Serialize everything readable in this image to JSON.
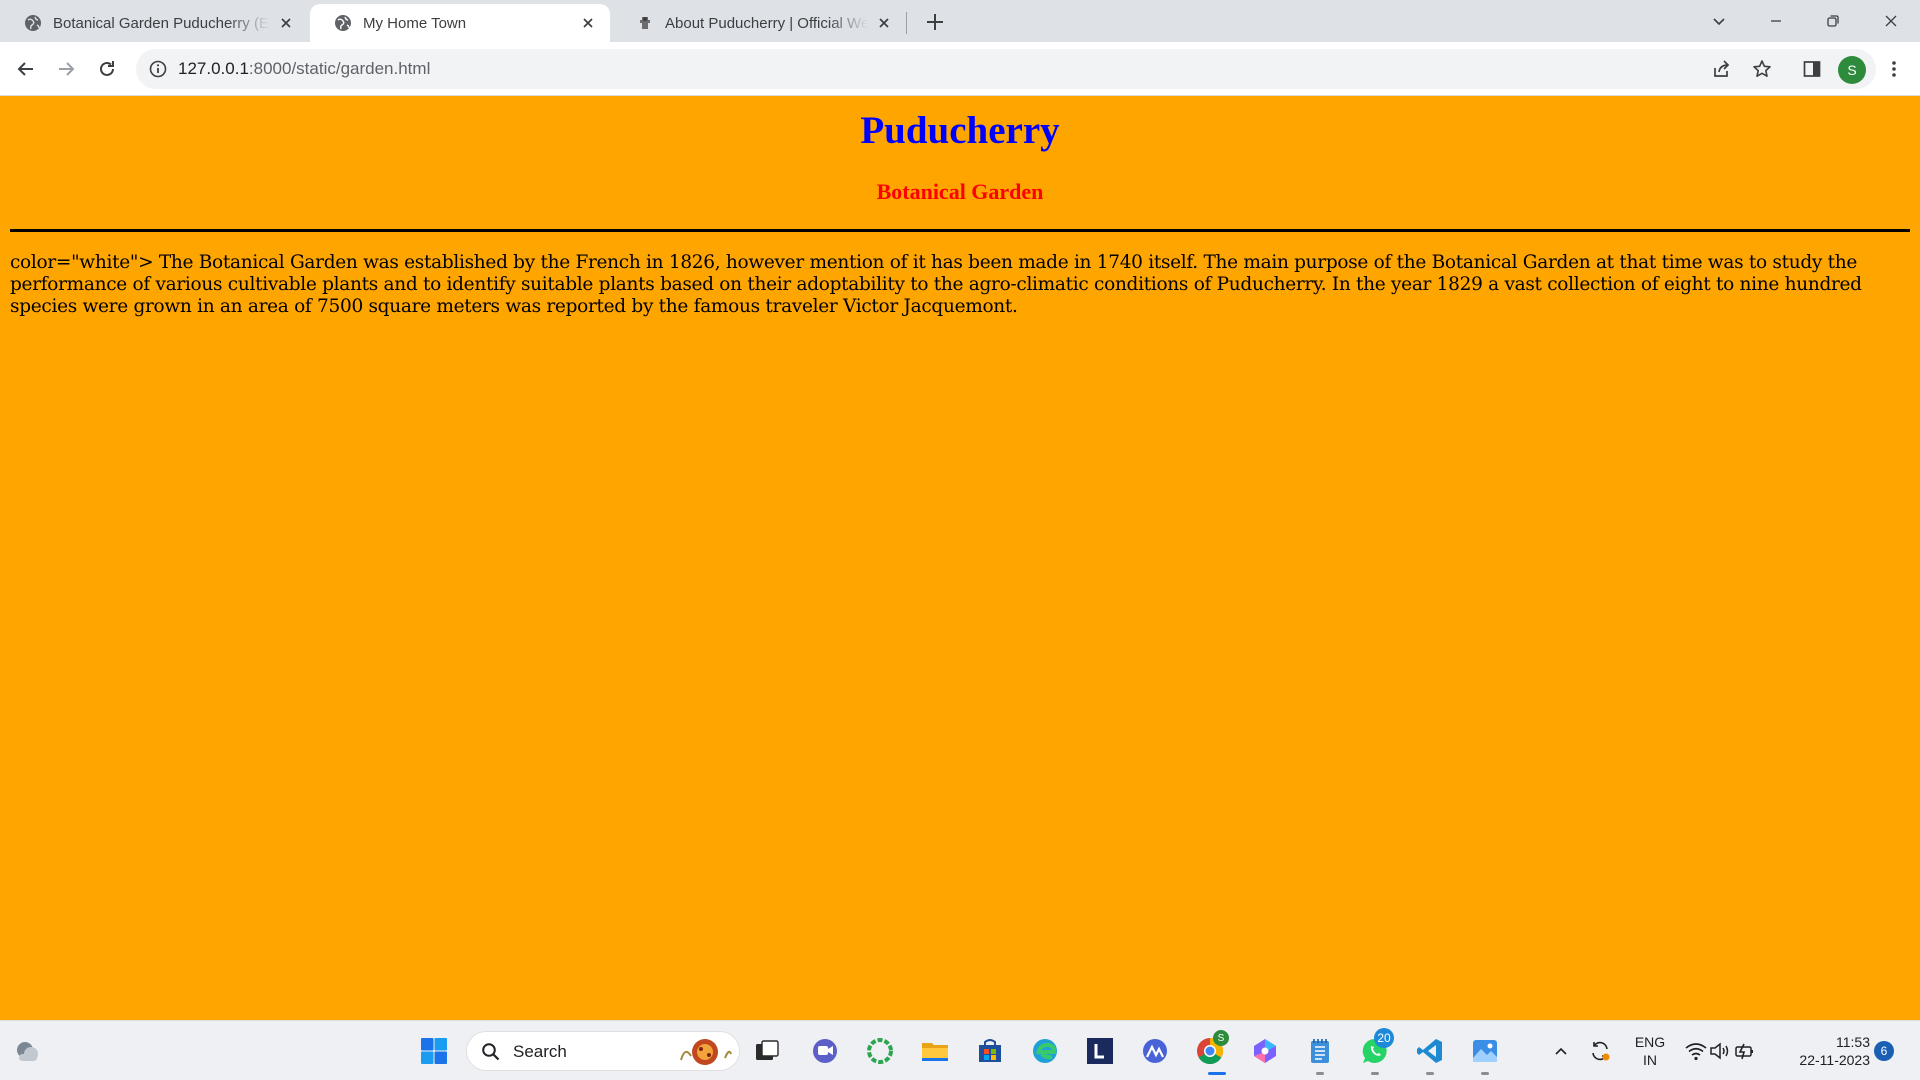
{
  "browser": {
    "tabs": [
      {
        "title": "Botanical Garden Puducherry (En",
        "active": false
      },
      {
        "title": "My Home Town",
        "active": true
      },
      {
        "title": "About Puducherry | Official Web",
        "active": false
      }
    ],
    "address": {
      "host": "127.0.0.1",
      "path": ":8000/static/garden.html"
    },
    "profile_initial": "S"
  },
  "page": {
    "heading": "Puducherry",
    "subheading": "Botanical Garden",
    "paragraph": "color=\"white\"> The Botanical Garden was established by the French in 1826, however mention of it has been made in 1740 itself. The main purpose of the Botanical Garden at that time was to study the performance of various cultivable plants and to identify suitable plants based on their adoptability to the agro-climatic conditions of Puducherry. In the year 1829 a vast collection of eight to nine hundred species were grown in an area of 7500 square meters was reported by the famous traveler Victor Jacquemont.",
    "background_color": "#ffa500",
    "heading_color": "#0000ff",
    "subheading_color": "#ff0000"
  },
  "taskbar": {
    "search_label": "Search",
    "whatsapp_badge": "20",
    "chrome_badge": "S",
    "language": "ENG",
    "region": "IN",
    "time": "11:53",
    "date": "22-11-2023",
    "notification_count": "6"
  }
}
